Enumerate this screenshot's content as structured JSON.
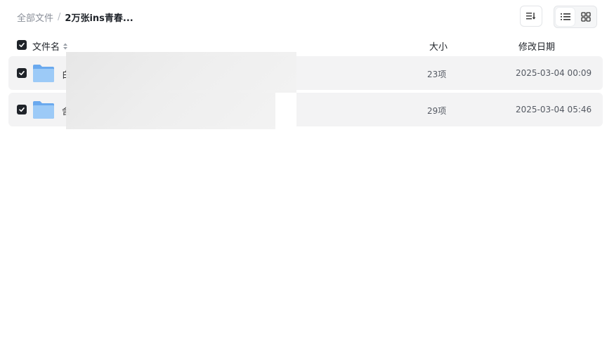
{
  "breadcrumb": {
    "root": "全部文件",
    "separator": "/",
    "current": "2万张ins青春..."
  },
  "toolbar": {
    "sort_icon": "sort-icon",
    "list_view_icon": "list-view-icon",
    "grid_view_icon": "grid-view-icon",
    "active_view": "list"
  },
  "columns": {
    "name": "文件名",
    "size": "大小",
    "modified": "修改日期"
  },
  "files": [
    {
      "name": "白",
      "type": "folder",
      "size": "23项",
      "modified": "2025-03-04 00:09",
      "checked": true
    },
    {
      "name": "舍",
      "type": "folder",
      "size": "29项",
      "modified": "2025-03-04 05:46",
      "checked": true
    }
  ],
  "colors": {
    "row_background": "#f3f3f4",
    "checkbox": "#1f2329",
    "folder_blue": "#7fb6f2"
  }
}
